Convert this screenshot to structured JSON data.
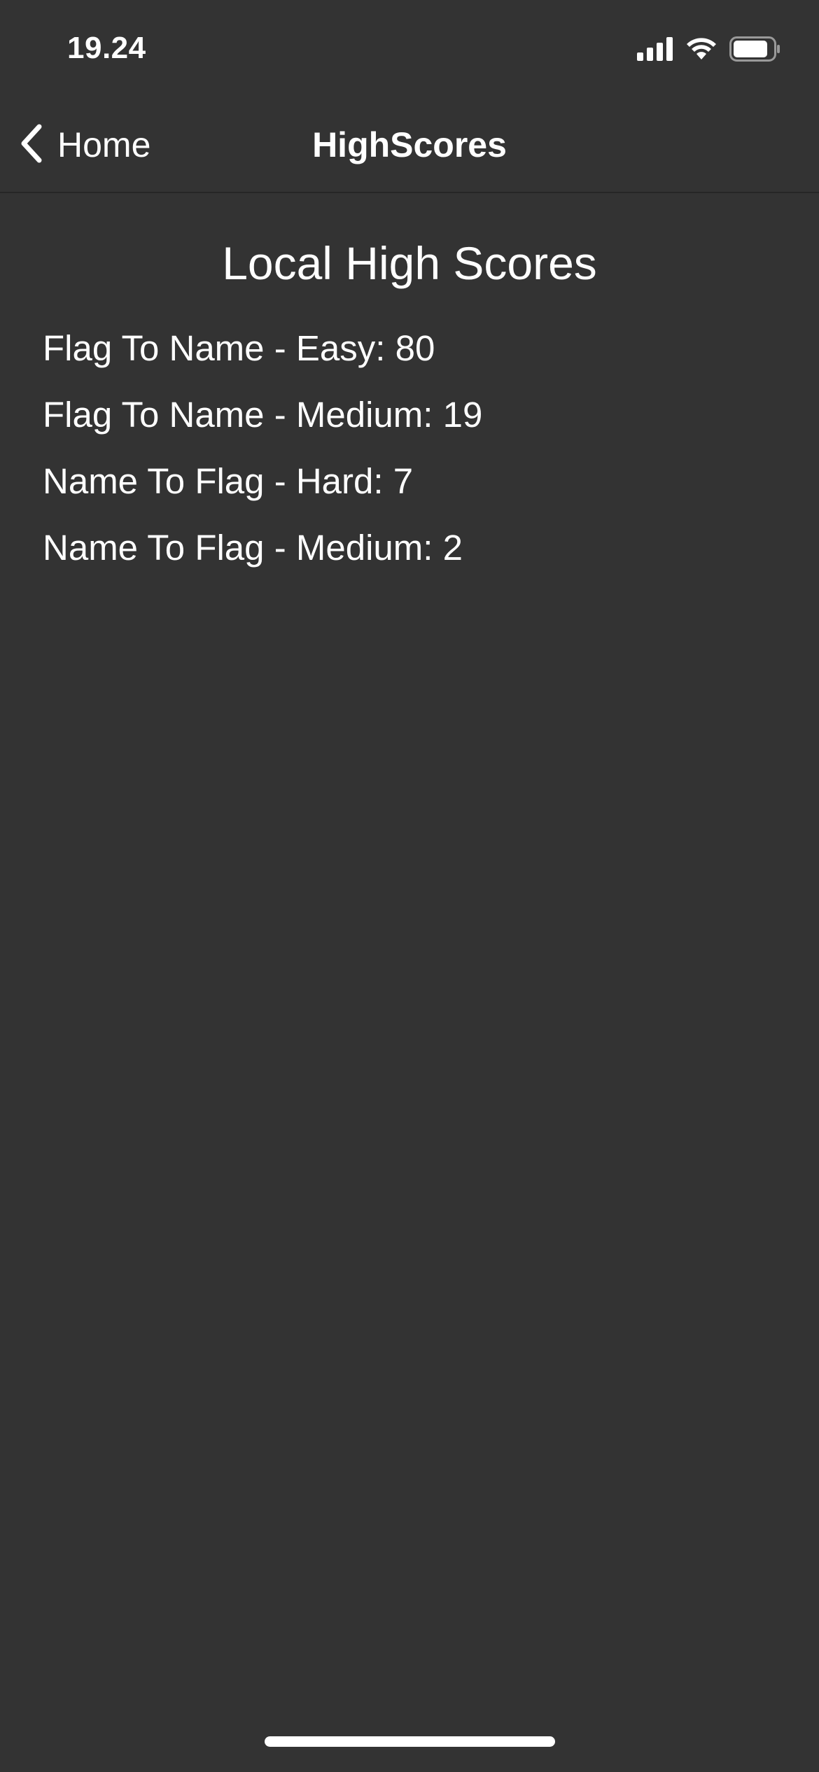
{
  "status_bar": {
    "time": "19.24",
    "icons": [
      "cellular-signal-icon",
      "wifi-icon",
      "battery-icon"
    ]
  },
  "nav": {
    "back_label": "Home",
    "title": "HighScores"
  },
  "content": {
    "title": "Local High Scores",
    "scores": [
      "Flag To Name - Easy: 80",
      "Flag To Name - Medium: 19",
      "Name To Flag - Hard: 7",
      "Name To Flag - Medium: 2"
    ]
  },
  "colors": {
    "background": "#333333",
    "text": "#ffffff",
    "divider": "#262626"
  }
}
